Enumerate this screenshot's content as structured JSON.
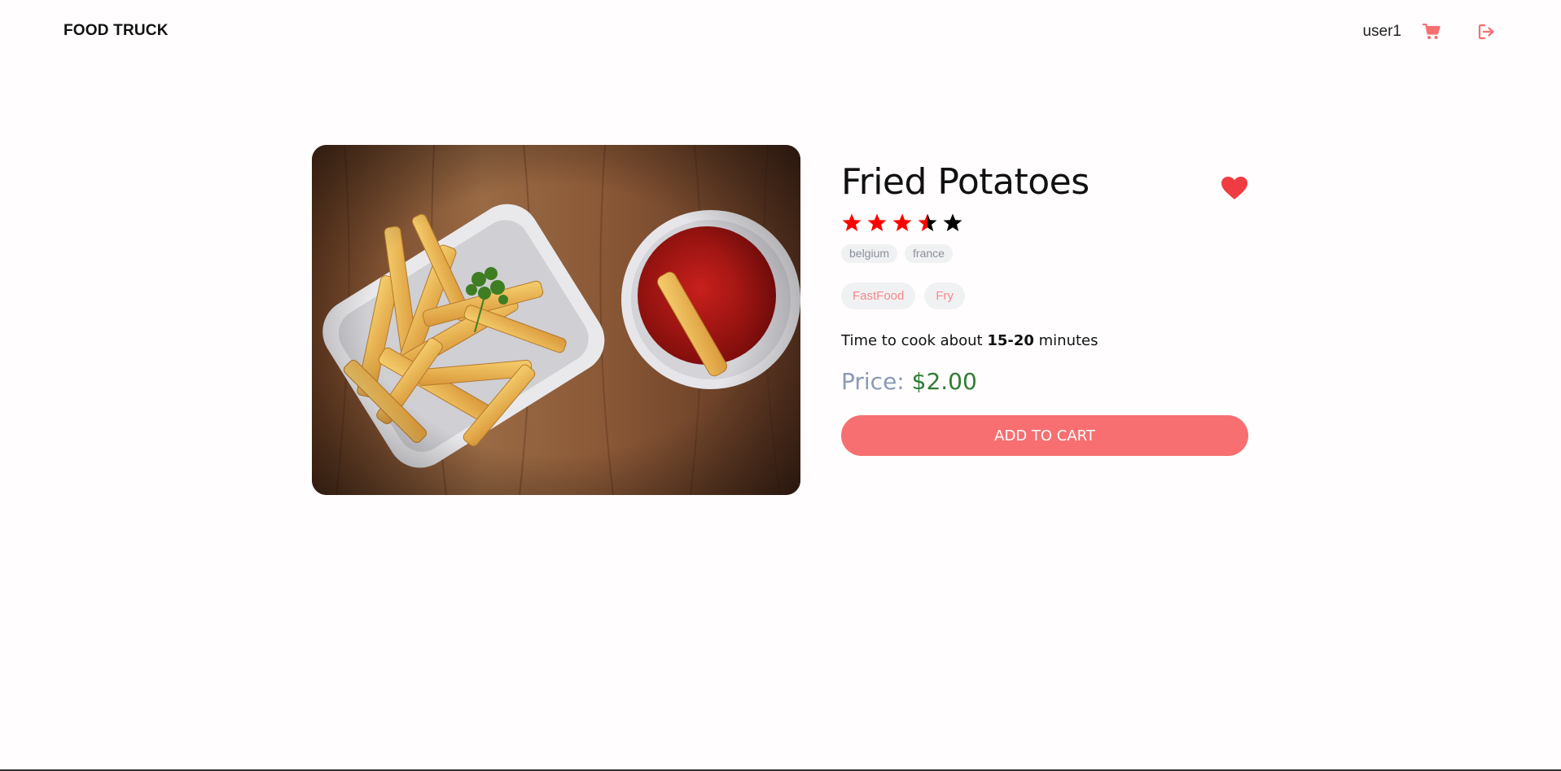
{
  "header": {
    "logo": "FOOD TRUCK",
    "username": "user1",
    "cart_icon": "cart-icon",
    "logout_icon": "logout-icon"
  },
  "food": {
    "name": "Fried Potatoes",
    "favorite": true,
    "favorite_icon": "heart-icon",
    "rating": 3.5,
    "rating_max": 5,
    "origins": [
      "belgium",
      "france"
    ],
    "tags": [
      "FastFood",
      "Fry"
    ],
    "cook_prefix": "Time to cook about",
    "cook_time": "15-20",
    "cook_suffix": "minutes",
    "price_label": "Price:",
    "price_value": "$2.00",
    "add_to_cart_label": "ADD TO CART",
    "image_alt": "french fries with ketchup"
  },
  "colors": {
    "accent": "#f76f71",
    "star_filled": "#ff0000",
    "star_empty": "#000000",
    "price_value": "#2e7d32",
    "price_label": "#8a9ab7",
    "heart": "#ef3b42"
  }
}
